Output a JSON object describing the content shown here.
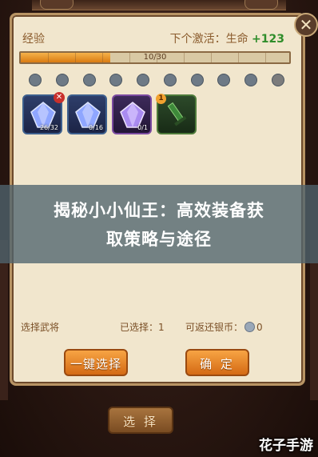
{
  "panel": {
    "exp_label": "经验",
    "next_activation_label": "下个激活：生命",
    "next_activation_bonus": "+123",
    "exp_bar": {
      "current": 10,
      "max": 30,
      "text": "10/30",
      "progress": 0.333
    },
    "close_symbol": "✕",
    "slot_dots": {
      "filled": 9,
      "empty": 1
    }
  },
  "items": [
    {
      "icon": "blue-crystal-icon",
      "count": "26/32",
      "badge": "✕",
      "rarity": "blue"
    },
    {
      "icon": "blue-crystal-icon",
      "count": "0/16",
      "rarity": "blue"
    },
    {
      "icon": "purple-crystal-icon",
      "count": "0/1",
      "rarity": "purple"
    },
    {
      "icon": "green-sword-icon",
      "level_badge": "1",
      "rarity": "green"
    }
  ],
  "overlay": {
    "line1": "揭秘小小仙王：高效装备获",
    "line2": "取策略与途径"
  },
  "footer": {
    "select_general": "选择武将",
    "selected_label": "已选择：1",
    "returnable_label": "可返还银币：",
    "returnable_value": "0",
    "auto_select_button": "一键选择",
    "confirm_button": "确 定",
    "bottom_select_button": "选 择"
  },
  "watermark": "花子手游",
  "colors": {
    "accent_orange": "#d97b12",
    "bonus_green": "#2f8d2a",
    "panel_bg": "#f1e6cd"
  }
}
